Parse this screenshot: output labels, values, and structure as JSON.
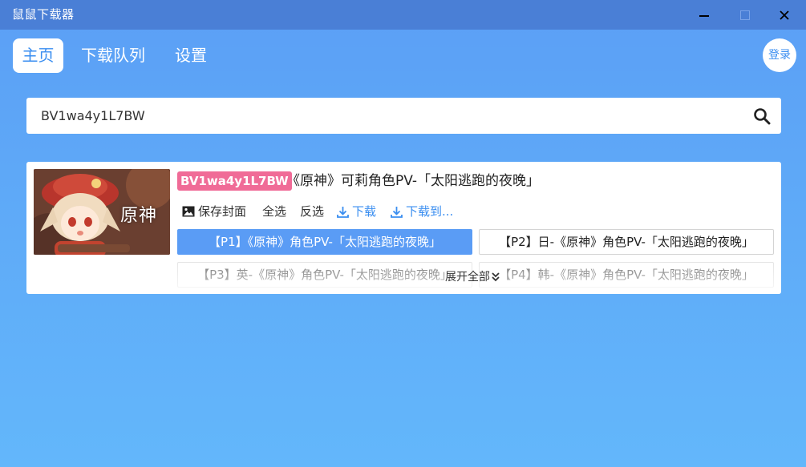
{
  "app": {
    "title": "鼠鼠下载器"
  },
  "nav": {
    "tabs": [
      {
        "label": "主页",
        "active": true
      },
      {
        "label": "下载队列",
        "active": false
      },
      {
        "label": "设置",
        "active": false
      }
    ],
    "login_label": "登录"
  },
  "search": {
    "value": "BV1wa4y1L7BW",
    "icon": "search-icon"
  },
  "result": {
    "bvid": "BV1wa4y1L7BW",
    "title": "《原神》可莉角色PV-「太阳逃跑的夜晚」",
    "thumbnail_logo": "原神",
    "actions": {
      "save_cover": "保存封面",
      "select_all": "全选",
      "invert": "反选",
      "download": "下载",
      "download_to": "下载到..."
    },
    "parts": [
      {
        "label": "【P1】《原神》角色PV-「太阳逃跑的夜晚」",
        "selected": true
      },
      {
        "label": "【P2】日-《原神》角色PV-「太阳逃跑的夜晚」",
        "selected": false
      },
      {
        "label": "【P3】英-《原神》角色PV-「太阳逃跑的夜晚」",
        "selected": false
      },
      {
        "label": "【P4】韩-《原神》角色PV-「太阳逃跑的夜晚」",
        "selected": false
      }
    ],
    "expand_all": "展开全部"
  },
  "colors": {
    "accent": "#3a8ef0",
    "titlebar": "#4a7fd6",
    "badge": "#f06b97",
    "selected_part": "#5a9cf5"
  }
}
